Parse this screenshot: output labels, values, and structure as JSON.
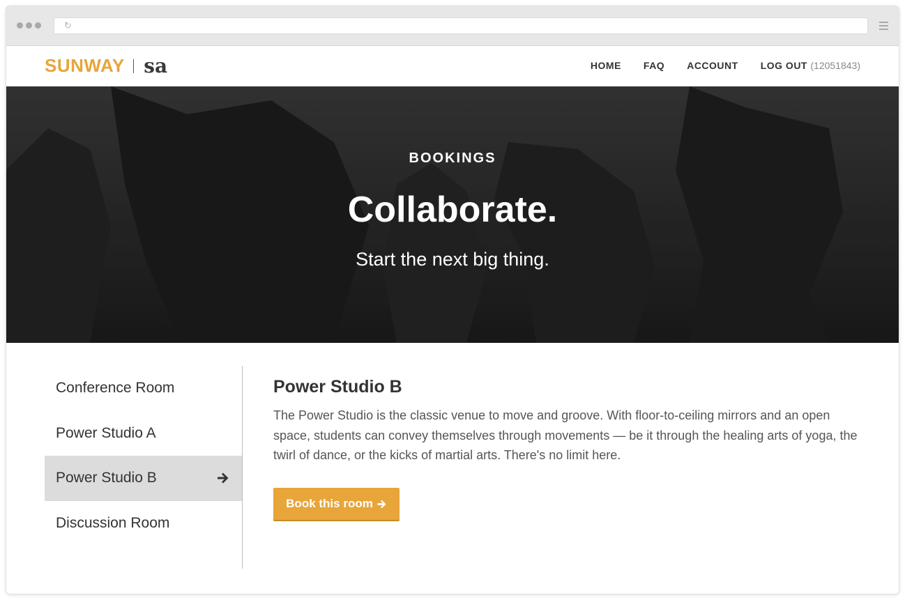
{
  "browser": {
    "url": ""
  },
  "nav": {
    "logo_brand": "SUNWAY",
    "logo_sub": "sa",
    "links": [
      {
        "label": "HOME"
      },
      {
        "label": "FAQ"
      },
      {
        "label": "ACCOUNT"
      },
      {
        "label": "LOG OUT",
        "suffix": "(12051843)"
      }
    ]
  },
  "hero": {
    "eyebrow": "BOOKINGS",
    "title": "Collaborate.",
    "subtitle": "Start the next big thing."
  },
  "sidebar": {
    "items": [
      {
        "label": "Conference Room",
        "active": false
      },
      {
        "label": "Power Studio A",
        "active": false
      },
      {
        "label": "Power Studio B",
        "active": true,
        "icon": "arrow-right-icon"
      },
      {
        "label": "Discussion Room",
        "active": false
      }
    ]
  },
  "main": {
    "title": "Power Studio B",
    "description": "The Power Studio is the classic venue to move and groove. With floor-to-ceiling mirrors and an open space, students can convey themselves through movements — be it through the healing arts of yoga, the twirl of dance, or the kicks of martial arts. There's no limit here.",
    "book_button": "Book this room",
    "book_button_icon": "arrow-right-icon"
  },
  "colors": {
    "accent": "#e8a53a",
    "text_dark": "#333333",
    "active_bg": "#dcdcdc"
  }
}
